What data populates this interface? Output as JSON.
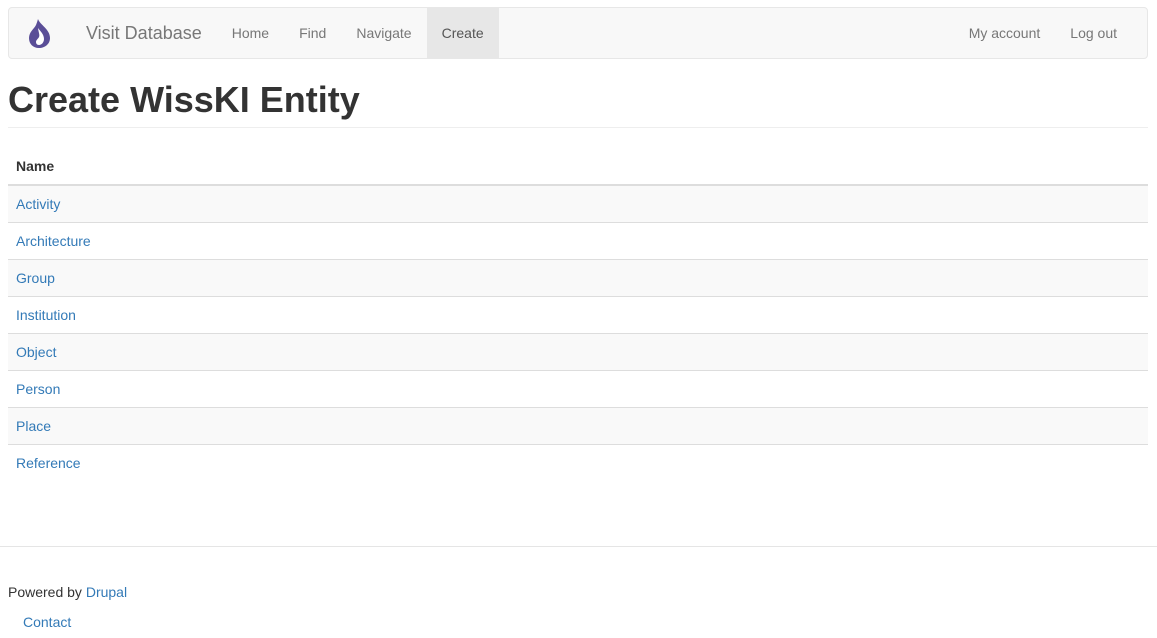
{
  "navbar": {
    "logo_icon": "drupal-drop-icon",
    "brand": "Visit Database",
    "links": [
      {
        "label": "Home"
      },
      {
        "label": "Find"
      },
      {
        "label": "Navigate"
      },
      {
        "label": "Create",
        "active": true
      }
    ],
    "right_links": [
      {
        "label": "My account"
      },
      {
        "label": "Log out"
      }
    ]
  },
  "page": {
    "title": "Create WissKI Entity"
  },
  "table": {
    "header": "Name",
    "rows": [
      {
        "name": "Activity"
      },
      {
        "name": "Architecture"
      },
      {
        "name": "Group"
      },
      {
        "name": "Institution"
      },
      {
        "name": "Object"
      },
      {
        "name": "Person"
      },
      {
        "name": "Place"
      },
      {
        "name": "Reference"
      }
    ]
  },
  "footer": {
    "powered_prefix": "Powered by",
    "powered_link": "Drupal",
    "contact": "Contact"
  },
  "colors": {
    "link": "#337ab7",
    "logo": "#5a4e97",
    "navbar_bg": "#f8f8f8",
    "active_tab_bg": "#e7e7e7"
  }
}
